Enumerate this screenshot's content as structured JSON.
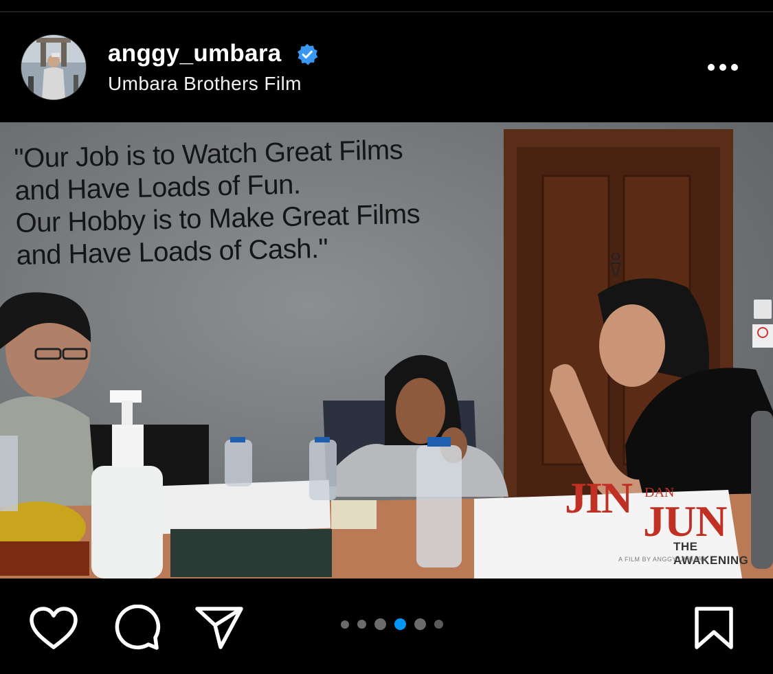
{
  "post": {
    "username": "anggy_umbara",
    "subtitle": "Umbara Brothers Film"
  },
  "photo": {
    "wall_quote": "\"Our Job is to Watch Great Films\nand Have Loads of Fun.\nOur Hobby is to Make Great Films\nand Have Loads of Cash.\"",
    "logo": {
      "word1": "JIN",
      "word2": "DAN",
      "word3": "JUN",
      "tagline": "THE AWAKENING",
      "credit": "A FILM BY ANGGY UMBARA"
    }
  },
  "carousel": {
    "total": 6,
    "active_index": 3
  },
  "icons": {
    "verified": "verified-badge-icon",
    "more": "more-options-icon",
    "like": "heart-icon",
    "comment": "comment-icon",
    "share": "send-icon",
    "save": "bookmark-icon"
  },
  "colors": {
    "background": "#000000",
    "verified_blue": "#3897f0",
    "active_dot": "#0095f6",
    "logo_red": "#c03025"
  }
}
